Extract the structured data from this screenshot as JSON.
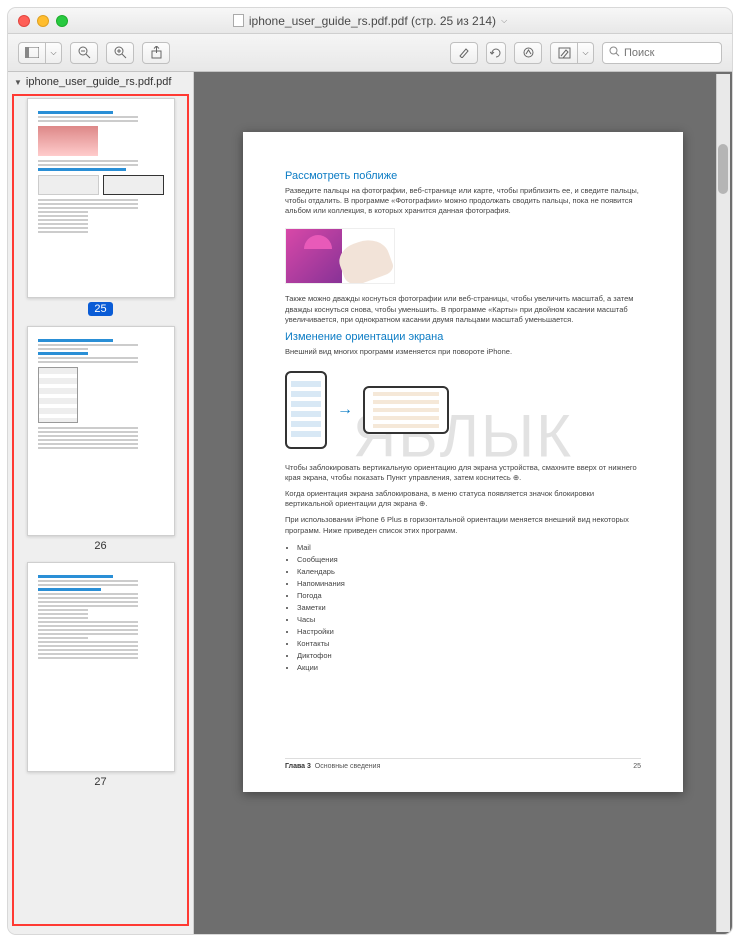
{
  "window": {
    "title": "iphone_user_guide_rs.pdf.pdf (стр. 25 из 214)"
  },
  "toolbar": {
    "search_placeholder": "Поиск"
  },
  "sidebar": {
    "filename": "iphone_user_guide_rs.pdf.pdf",
    "pages": [
      {
        "num": "25",
        "current": true
      },
      {
        "num": "26",
        "current": false
      },
      {
        "num": "27",
        "current": false
      }
    ]
  },
  "page": {
    "h1": "Рассмотреть поближе",
    "p1": "Разведите пальцы на фотографии, веб-странице или карте, чтобы приблизить ее, и сведите пальцы, чтобы отдалить. В программе «Фотографии» можно продолжать сводить пальцы, пока не появится альбом или коллекция, в которых хранится данная фотография.",
    "p2": "Также можно дважды коснуться фотографии или веб-страницы, чтобы увеличить масштаб, а затем дважды коснуться снова, чтобы уменьшить. В программе «Карты» при двойном касании масштаб увеличивается, при однократном касании двумя пальцами масштаб уменьшается.",
    "h2": "Изменение ориентации экрана",
    "p3": "Внешний вид многих программ изменяется при повороте iPhone.",
    "p4": "Чтобы заблокировать вертикальную ориентацию для экрана устройства, смахните вверх от нижнего края экрана, чтобы показать Пункт управления, затем коснитесь ⊕.",
    "p5": "Когда ориентация экрана заблокирована, в меню статуса появляется значок блокировки вертикальной ориентации для экрана ⊕.",
    "p6": "При использовании iPhone 6 Plus в горизонтальной ориентации меняется внешний вид некоторых программ. Ниже приведен список этих программ.",
    "bullets": [
      "Mail",
      "Сообщения",
      "Календарь",
      "Напоминания",
      "Погода",
      "Заметки",
      "Часы",
      "Настройки",
      "Контакты",
      "Диктофон",
      "Акции"
    ],
    "footer_chapter": "Глава 3",
    "footer_section": "Основные сведения",
    "footer_pagenum": "25"
  },
  "watermark": "ЯБЛЫК"
}
